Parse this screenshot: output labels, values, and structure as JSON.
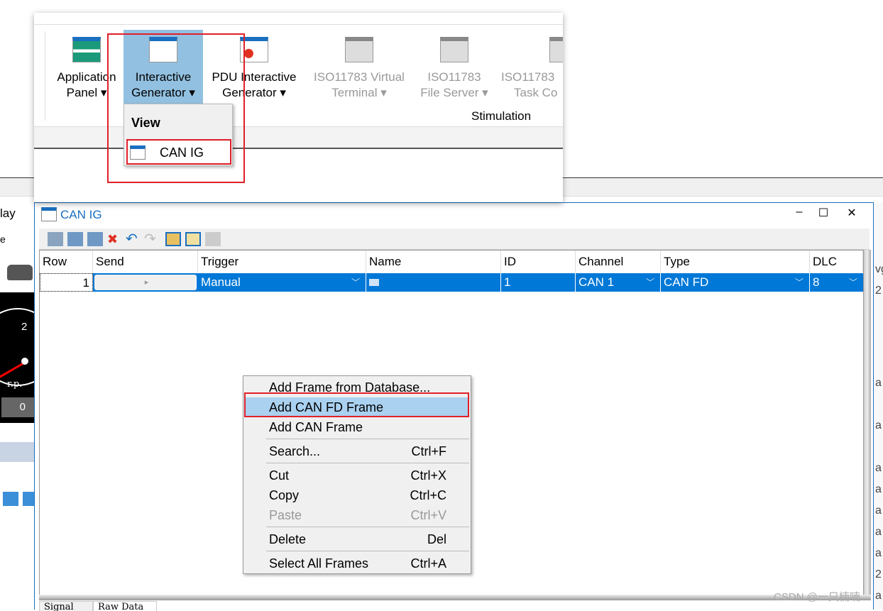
{
  "background": {
    "left_label": "lay",
    "left_label2": "e",
    "gauge_tick": "2",
    "gauge_unit": "r.p.",
    "gauge_value": "0",
    "right_rows": [
      "vg",
      "2",
      "a",
      "a",
      "a",
      "a",
      "a",
      "a",
      "a",
      "2",
      "a"
    ]
  },
  "window": {
    "title": "CAN IG",
    "minimize": "–",
    "maximize": "☐",
    "close": "✕"
  },
  "toolbar": {
    "icons": [
      "add-frame-from-database-icon",
      "add-can-fd-frame-icon",
      "add-can-frame-icon",
      "delete-icon",
      "undo-icon",
      "redo-icon",
      "signal-view-icon",
      "graphics-icon",
      "sync-icon"
    ]
  },
  "grid": {
    "columns": [
      "Row",
      "Send",
      "Trigger",
      "Name",
      "ID",
      "Channel",
      "Type",
      "DLC"
    ],
    "rows": [
      {
        "row": "1",
        "send": "▸",
        "trigger": "Manual",
        "name": "",
        "id": "1",
        "channel": "CAN 1",
        "type": "CAN FD",
        "dlc": "8"
      }
    ],
    "selected_color": "#0078d7"
  },
  "bottom_tabs": [
    "Signal",
    "Raw Data"
  ],
  "ribbon": {
    "buttons": [
      {
        "line1": "Application",
        "line2": "Panel ▾",
        "enabled": true
      },
      {
        "line1": "Interactive",
        "line2": "Generator ▾",
        "enabled": true,
        "selected": true
      },
      {
        "line1": "PDU Interactive",
        "line2": "Generator ▾",
        "enabled": true
      },
      {
        "line1": "ISO11783 Virtual",
        "line2": "Terminal ▾",
        "enabled": false
      },
      {
        "line1": "ISO11783",
        "line2": "File Server ▾",
        "enabled": false
      },
      {
        "line1": "ISO11783",
        "line2": "Task Co",
        "enabled": false
      }
    ],
    "group_label": "Stimulation",
    "dropdown": {
      "header": "View",
      "item": "CAN IG"
    }
  },
  "context_menu": [
    {
      "label": "Add Frame from Database...",
      "shortcut": ""
    },
    {
      "label": "Add CAN FD Frame",
      "shortcut": "",
      "highlighted": true
    },
    {
      "label": "Add CAN Frame",
      "shortcut": ""
    },
    {
      "label": "Search...",
      "shortcut": "Ctrl+F"
    },
    {
      "label": "Cut",
      "shortcut": "Ctrl+X"
    },
    {
      "label": "Copy",
      "shortcut": "Ctrl+C"
    },
    {
      "label": "Paste",
      "shortcut": "Ctrl+V",
      "disabled": true
    },
    {
      "label": "Delete",
      "shortcut": "Del"
    },
    {
      "label": "Select All Frames",
      "shortcut": "Ctrl+A"
    }
  ],
  "highlight_color": "#e0202a",
  "watermark": "CSDN @一只楠喃"
}
